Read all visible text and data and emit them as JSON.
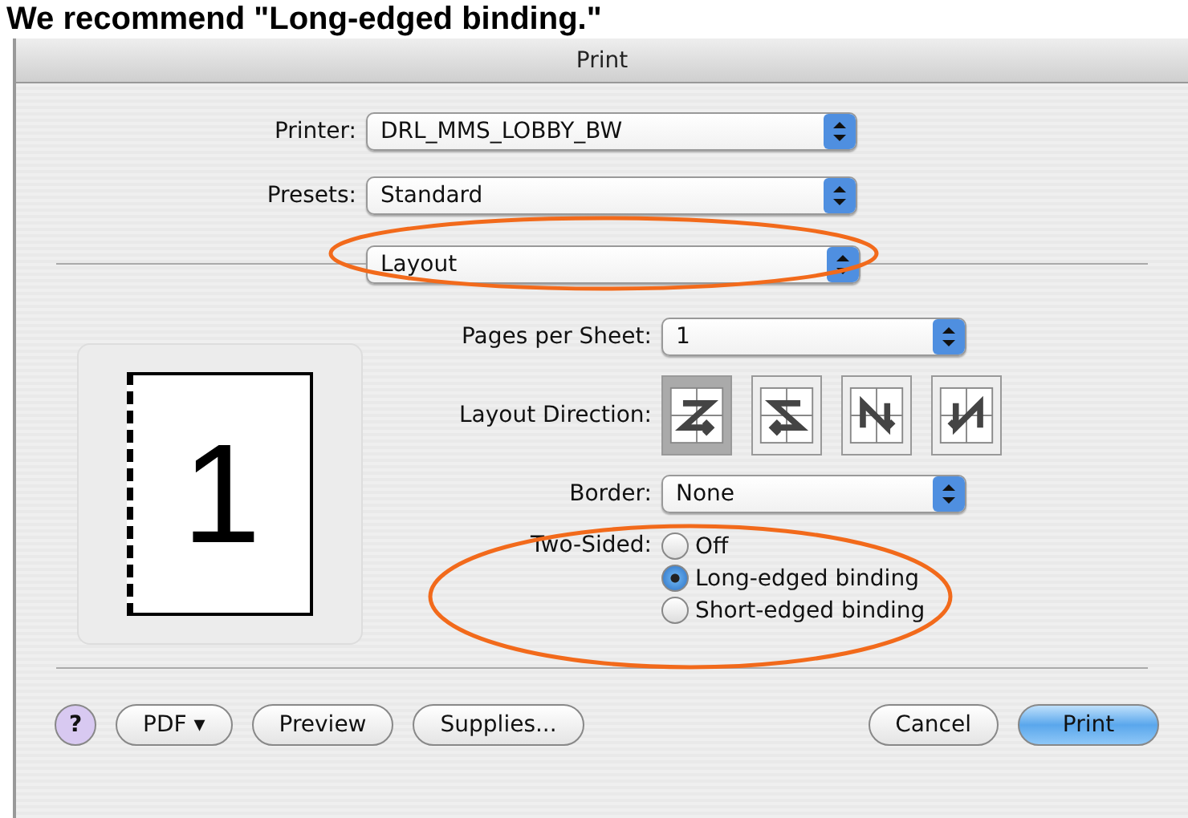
{
  "caption": "We recommend \"Long-edged binding.\"",
  "window": {
    "title": "Print"
  },
  "printer": {
    "label": "Printer:",
    "value": "DRL_MMS_LOBBY_BW"
  },
  "presets": {
    "label": "Presets:",
    "value": "Standard"
  },
  "panel": {
    "value": "Layout"
  },
  "preview": {
    "page_number": "1"
  },
  "pages_per_sheet": {
    "label": "Pages per Sheet:",
    "value": "1"
  },
  "layout_direction": {
    "label": "Layout Direction:",
    "options": [
      {
        "kind": "z",
        "selected": true
      },
      {
        "kind": "s",
        "selected": false
      },
      {
        "kind": "n-down",
        "selected": false
      },
      {
        "kind": "n-mirror",
        "selected": false
      }
    ]
  },
  "border": {
    "label": "Border:",
    "value": "None"
  },
  "two_sided": {
    "label": "Two-Sided:",
    "options": [
      {
        "label": "Off",
        "selected": false
      },
      {
        "label": "Long-edged binding",
        "selected": true
      },
      {
        "label": "Short-edged binding",
        "selected": false
      }
    ]
  },
  "buttons": [
    {
      "kind": "help",
      "label": "?"
    },
    {
      "kind": "menu",
      "label": "PDF ▾"
    },
    {
      "kind": "plain",
      "label": "Preview"
    },
    {
      "kind": "plain",
      "label": "Supplies..."
    },
    {
      "kind": "spacer"
    },
    {
      "kind": "plain",
      "label": "Cancel"
    },
    {
      "kind": "default",
      "label": "Print"
    }
  ]
}
